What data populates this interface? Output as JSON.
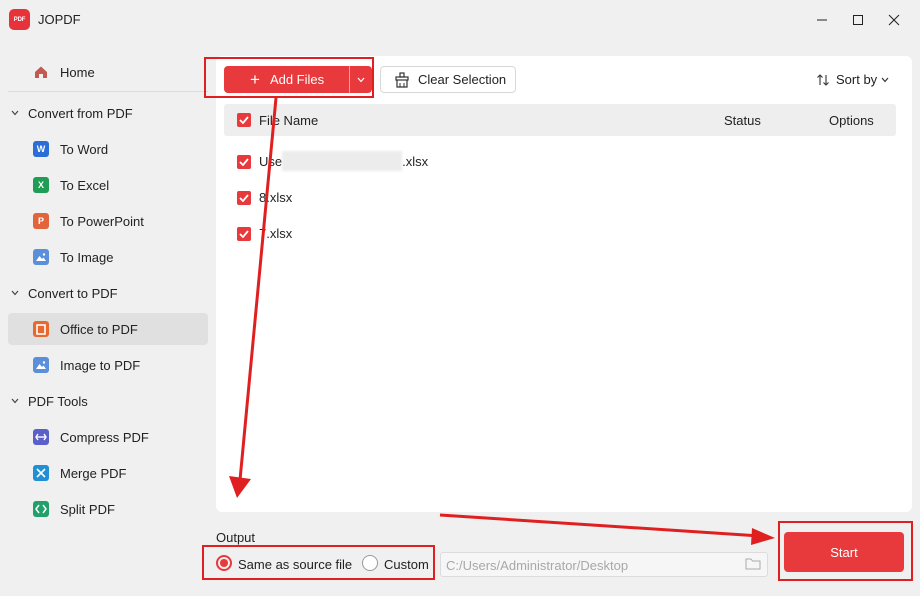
{
  "app": {
    "logo_text": "PDF",
    "title": "JOPDF"
  },
  "window_controls": [
    "minimize-icon",
    "maximize-icon",
    "close-icon"
  ],
  "sidebar": {
    "home": {
      "label": "Home",
      "icon": "home-icon"
    },
    "sections": [
      {
        "title": "Convert from PDF",
        "items": [
          {
            "label": "To Word",
            "icon": "word-icon",
            "color": "#2b6fd6",
            "glyph": "W"
          },
          {
            "label": "To Excel",
            "icon": "excel-icon",
            "color": "#1f9d55",
            "glyph": "X"
          },
          {
            "label": "To PowerPoint",
            "icon": "powerpoint-icon",
            "color": "#e2643c",
            "glyph": "P"
          },
          {
            "label": "To Image",
            "icon": "image-icon",
            "color": "#5b8fd9",
            "glyph": "▲"
          }
        ]
      },
      {
        "title": "Convert to PDF",
        "items": [
          {
            "label": "Office to PDF",
            "icon": "office-icon",
            "color": "#e8692e",
            "glyph": "O",
            "active": true
          },
          {
            "label": "Image to PDF",
            "icon": "image-to-pdf-icon",
            "color": "#5b8fd9",
            "glyph": "▲"
          }
        ]
      },
      {
        "title": "PDF Tools",
        "items": [
          {
            "label": "Compress PDF",
            "icon": "compress-icon",
            "color": "#5a5fc9",
            "glyph": "⇔"
          },
          {
            "label": "Merge PDF",
            "icon": "merge-icon",
            "color": "#1f8fd6",
            "glyph": "✕"
          },
          {
            "label": "Split PDF",
            "icon": "split-icon",
            "color": "#22a06b",
            "glyph": "‹›"
          }
        ]
      }
    ]
  },
  "toolbar": {
    "add_files": "Add Files",
    "clear_selection": "Clear Selection",
    "sort_by": "Sort by"
  },
  "table": {
    "headers": {
      "file_name": "File Name",
      "status": "Status",
      "options": "Options"
    },
    "rows": [
      {
        "prefix": "Use",
        "suffix": ".xlsx",
        "checked": true
      },
      {
        "prefix": "8.xlsx",
        "suffix": "",
        "checked": true
      },
      {
        "prefix": "7.xlsx",
        "suffix": "",
        "checked": true
      }
    ]
  },
  "output": {
    "label": "Output",
    "options": [
      {
        "label": "Same as source file",
        "selected": true
      },
      {
        "label": "Custom",
        "selected": false
      }
    ],
    "path": "C:/Users/Administrator/Desktop"
  },
  "start_button": "Start",
  "colors": {
    "accent": "#e8393c",
    "annotation": "#e02020"
  }
}
